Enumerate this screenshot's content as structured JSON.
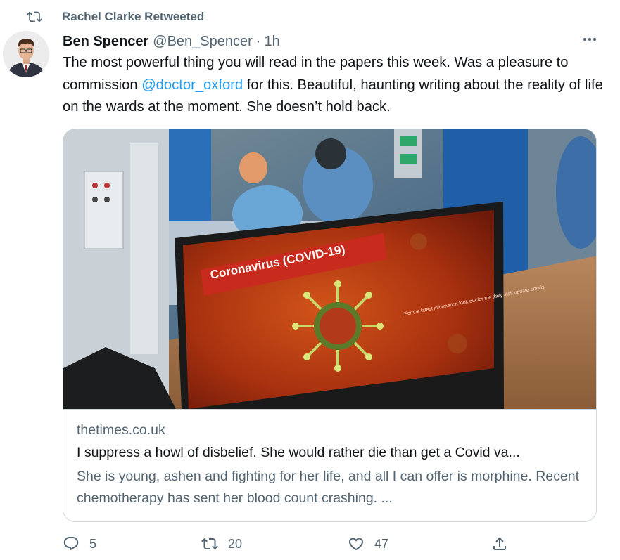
{
  "retweet_header": {
    "label": "Rachel Clarke Retweeted",
    "icon": "retweet-icon"
  },
  "author": {
    "name": "Ben Spencer",
    "handle": "@Ben_Spencer",
    "separator": "·",
    "time": "1h"
  },
  "tweet": {
    "text_before": "The most powerful thing you will read in the papers this week. Was a pleasure to commission ",
    "mention": "@doctor_oxford",
    "text_after": " for this. Beautiful, haunting writing about the reality of life on the wards at the moment. She doesn’t hold back."
  },
  "card": {
    "image_banner": "Coronavirus (COVID-19)",
    "image_small_text": "For the latest information look out for the daily staff update emails",
    "domain": "thetimes.co.uk",
    "title": "I suppress a howl of disbelief. She would rather die than get a Covid va...",
    "description": "She is young, ashen and fighting for her life, and all I can offer is morphine. Recent chemotherapy has sent her blood count crashing. ..."
  },
  "actions": {
    "reply_count": "5",
    "retweet_count": "20",
    "like_count": "47"
  },
  "colors": {
    "accent": "#1d9bf0",
    "secondary_text": "#536471",
    "primary_text": "#0f1419",
    "border": "#cfd9de"
  }
}
